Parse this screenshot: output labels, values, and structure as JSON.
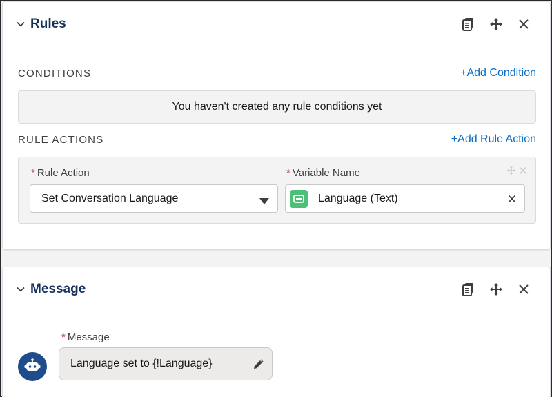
{
  "rules_card": {
    "title": "Rules",
    "conditions": {
      "label": "CONDITIONS",
      "add_link": "+Add Condition",
      "empty_text": "You haven't created any rule conditions yet"
    },
    "rule_actions": {
      "label": "RULE ACTIONS",
      "add_link": "+Add Rule Action",
      "rule_action_label": "Rule Action",
      "rule_action_value": "Set Conversation Language",
      "variable_name_label": "Variable Name",
      "variable_name_value": "Language (Text)",
      "required_marker": "*"
    }
  },
  "message_card": {
    "title": "Message",
    "message_label": "Message",
    "required_marker": "*",
    "message_text": "Language set to {!Language}"
  },
  "colors": {
    "title": "#16325c",
    "link": "#0b6ec9",
    "required": "#c23934",
    "variable_icon": "#4bc076",
    "bot_avatar": "#1f4d8c"
  },
  "icons": [
    "chevron-down-icon",
    "copy-icon",
    "move-icon",
    "close-icon",
    "dropdown-caret-icon",
    "variable-icon",
    "edit-pencil-icon",
    "bot-icon"
  ]
}
